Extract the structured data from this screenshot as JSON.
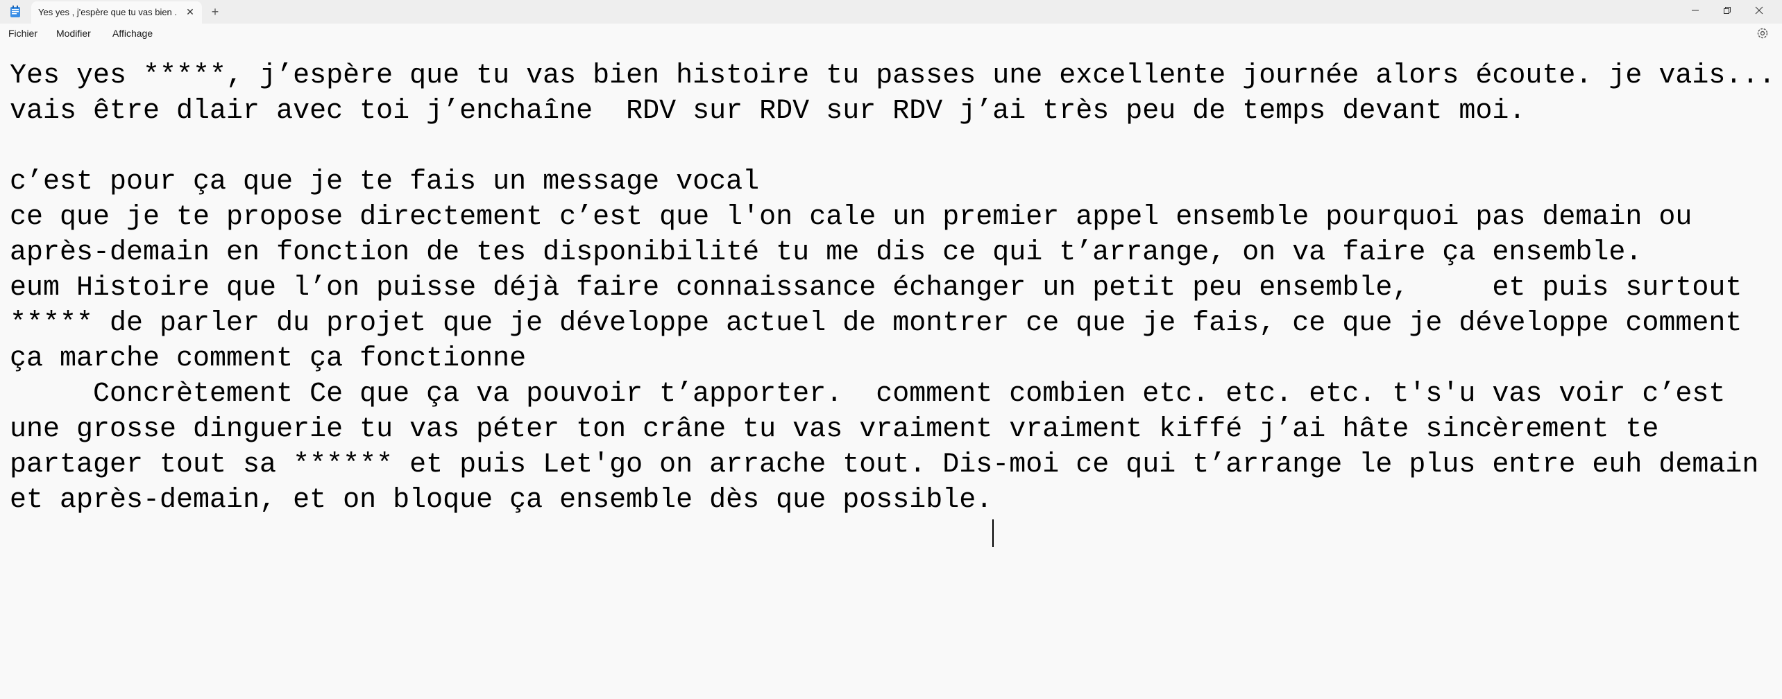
{
  "window": {
    "tab_title": "Yes yes , j'espère que tu vas bien .t",
    "tab_close_icon": "close-icon",
    "new_tab_icon": "plus-icon",
    "app_icon": "notepad-icon",
    "controls": {
      "minimize_icon": "minimize-icon",
      "maximize_icon": "maximize-icon",
      "close_icon": "close-icon"
    }
  },
  "menu": {
    "file": "Fichier",
    "edit": "Modifier",
    "view": "Affichage",
    "settings_icon": "gear-icon"
  },
  "document": {
    "lines": [
      "Yes yes *****, j’espère que tu vas bien histoire tu passes une excellente journée alors écoute. je vais...",
      "vais être dlair avec toi j’enchaîne  RDV sur RDV sur RDV j’ai très peu de temps devant moi.",
      "",
      "c’est pour ça que je te fais un message vocal",
      "ce que je te propose directement c’est que l'on cale un premier appel ensemble pourquoi pas demain ou",
      "après-demain en fonction de tes disponibilité tu me dis ce qui t’arrange, on va faire ça ensemble.",
      "eum Histoire que l’on puisse déjà faire connaissance échanger un petit peu ensemble,     et puis surtout",
      "***** de parler du projet que je développe actuel de montrer ce que je fais, ce que je développe comment",
      "ça marche comment ça fonctionne",
      "     Concrètement Ce que ça va pouvoir t’apporter.  comment combien etc. etc. etc. t's'u vas voir c’est",
      "une grosse dinguerie tu vas péter ton crâne tu vas vraiment vraiment kiffé j’ai hâte sincèrement te",
      "partager tout sa ****** et puis Let'go on arrache tout. Dis-moi ce qui t’arrange le plus entre euh demain",
      "et après-demain, et on bloque ça ensemble dès que possible."
    ]
  }
}
